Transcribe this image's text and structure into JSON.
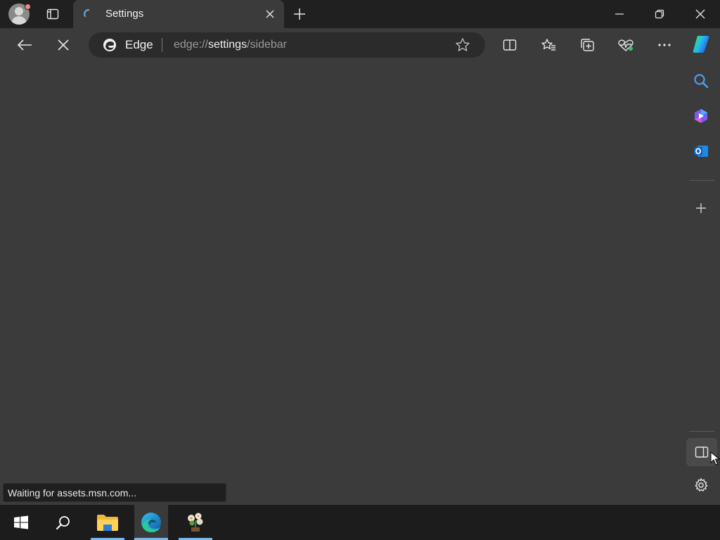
{
  "tabbar": {
    "tab": {
      "title": "Settings"
    }
  },
  "toolbar": {
    "site_label": "Edge",
    "url_scheme": "edge://",
    "url_host": "settings",
    "url_path": "/sidebar"
  },
  "status": {
    "text": "Waiting for assets.msn.com..."
  },
  "colors": {
    "background": "#3b3b3b",
    "tabbar": "#202020",
    "taskbar": "#1c1c1c",
    "accent": "#76b9ed"
  },
  "icons": {
    "tab_actions": "vertical-tabs-icon",
    "tab_loading": "loading-spinner-icon",
    "back": "back-arrow-icon",
    "stop": "stop-loading-icon",
    "favorite": "star-icon",
    "split": "split-screen-icon",
    "favorites": "favorites-icon",
    "collections": "collections-icon",
    "performance": "browser-essentials-icon",
    "more": "more-icon",
    "copilot": "copilot-icon",
    "sidebar_search": "search-icon",
    "sidebar_copilot": "copilot-designer-icon",
    "sidebar_outlook": "outlook-icon",
    "sidebar_add": "plus-icon",
    "sidebar_toggle": "hide-sidebar-icon",
    "sidebar_settings": "gear-icon",
    "taskbar_start": "windows-start-icon",
    "taskbar_search": "search-icon",
    "taskbar_explorer": "file-explorer-icon",
    "taskbar_edge": "edge-icon",
    "taskbar_app": "plant-app-icon"
  }
}
